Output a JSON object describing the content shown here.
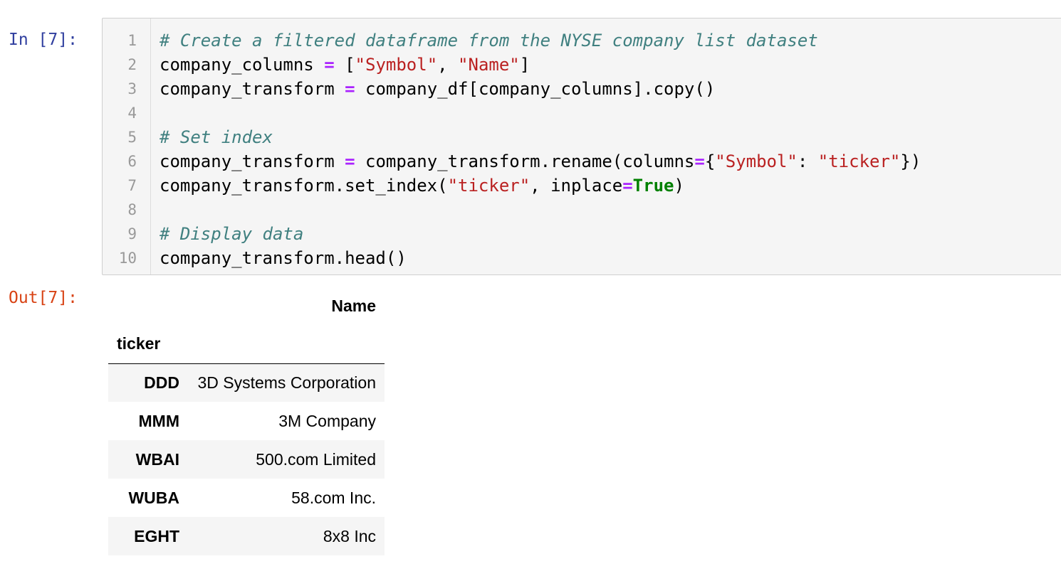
{
  "cell": {
    "in_prompt": "In [7]:",
    "out_prompt": "Out[7]:",
    "line_numbers": [
      "1",
      "2",
      "3",
      "4",
      "5",
      "6",
      "7",
      "8",
      "9",
      "10"
    ],
    "code": {
      "l1_comment": "# Create a filtered dataframe from the NYSE company list dataset",
      "l2_var": "company_columns ",
      "l2_op": "=",
      "l2_a": " [",
      "l2_s1": "\"Symbol\"",
      "l2_b": ", ",
      "l2_s2": "\"Name\"",
      "l2_c": "]",
      "l3_var": "company_transform ",
      "l3_op": "=",
      "l3_rest": " company_df[company_columns].copy()",
      "l5_comment": "# Set index",
      "l6_var": "company_transform ",
      "l6_op": "=",
      "l6_a": " company_transform.rename(columns",
      "l6_op2": "=",
      "l6_b": "{",
      "l6_s1": "\"Symbol\"",
      "l6_c": ": ",
      "l6_s2": "\"ticker\"",
      "l6_d": "})",
      "l7_a": "company_transform.set_index(",
      "l7_s1": "\"ticker\"",
      "l7_b": ", inplace",
      "l7_op": "=",
      "l7_kw": "True",
      "l7_c": ")",
      "l9_comment": "# Display data",
      "l10": "company_transform.head()"
    }
  },
  "output_table": {
    "column_header": "Name",
    "index_name": "ticker",
    "rows": [
      {
        "ticker": "DDD",
        "name": "3D Systems Corporation"
      },
      {
        "ticker": "MMM",
        "name": "3M Company"
      },
      {
        "ticker": "WBAI",
        "name": "500.com Limited"
      },
      {
        "ticker": "WUBA",
        "name": "58.com Inc."
      },
      {
        "ticker": "EGHT",
        "name": "8x8 Inc"
      }
    ]
  }
}
